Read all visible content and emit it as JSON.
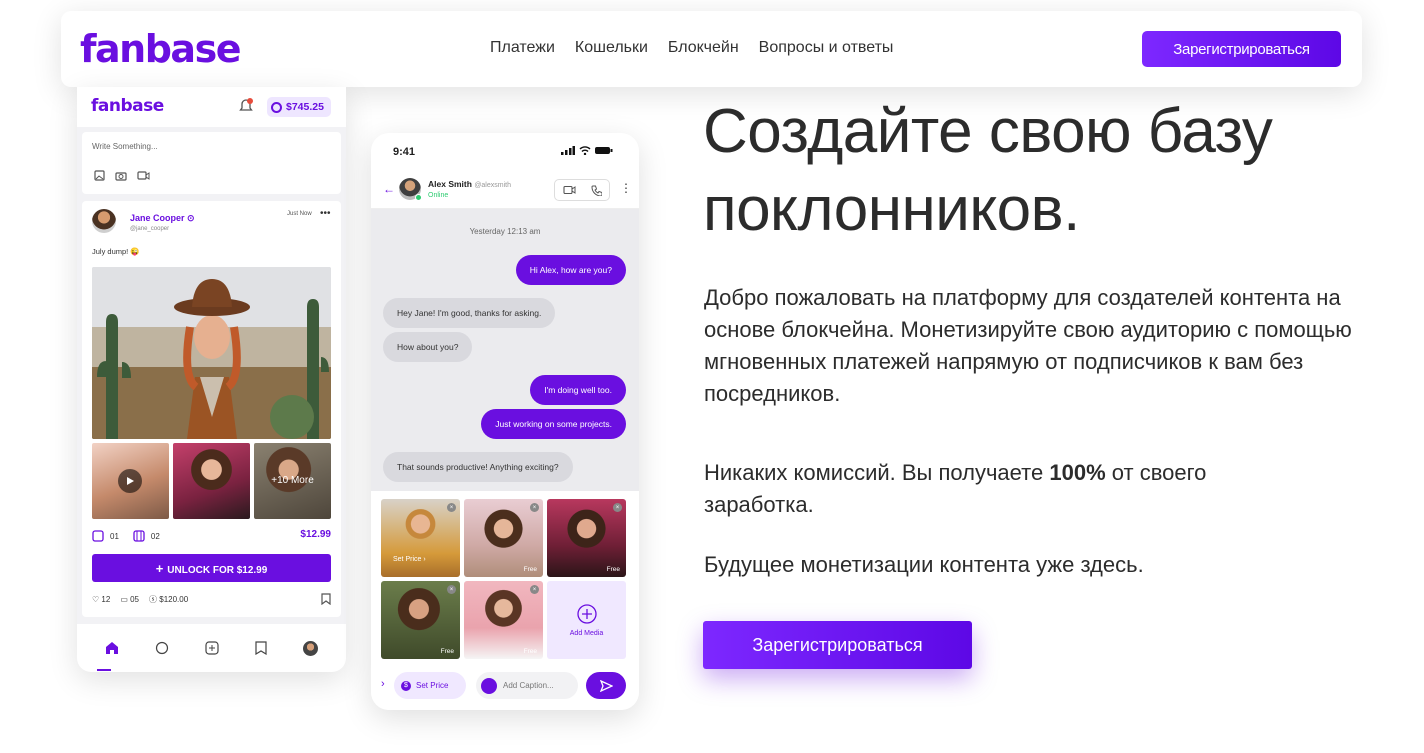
{
  "nav": {
    "logo": "fanbase",
    "links": [
      "Платежи",
      "Кошельки",
      "Блокчейн",
      "Вопросы и ответы"
    ],
    "register": "Зарегистрироваться"
  },
  "feed_mock": {
    "logo": "fanbase",
    "notification_count": "1",
    "balance": "$745.25",
    "write_placeholder": "Write Something...",
    "post": {
      "author": "Jane Cooper",
      "handle": "@jane_cooper",
      "time": "Just Now",
      "text": "July dump! 😜",
      "more_label": "+10 More",
      "images_count": "01",
      "videos_count": "02",
      "price": "$12.99",
      "unlock": "UNLOCK FOR $12.99",
      "likes": "12",
      "comments": "05",
      "tips": "$120.00"
    }
  },
  "phone_mock": {
    "time": "9:41",
    "contact": {
      "name": "Alex Smith",
      "handle": "@alexsmith",
      "status": "Online"
    },
    "day_label": "Yesterday 12:13 am",
    "messages": [
      {
        "dir": "out",
        "text": "Hi Alex, how are you?"
      },
      {
        "dir": "in",
        "text": "Hey Jane! I'm good, thanks for asking."
      },
      {
        "dir": "in",
        "text": "How about you?"
      },
      {
        "dir": "out",
        "text": "I'm doing well too."
      },
      {
        "dir": "out",
        "text": "Just working on some projects."
      },
      {
        "dir": "in",
        "text": "That sounds productive! Anything exciting?"
      }
    ],
    "media": {
      "set_price_label": "Set Price ›",
      "free_label": "Free",
      "add_media": "Add Media"
    },
    "compose": {
      "set_price": "Set Price",
      "caption_placeholder": "Add Caption..."
    }
  },
  "hero": {
    "title": "Создайте свою базу поклонников.",
    "p1": "Добро пожаловать на платформу для создателей контента на основе блокчейна. Монетизируйте свою аудиторию с помощью мгновенных платежей напрямую от подписчиков к вам без посредников.",
    "p2_pre": "Никаких комиссий. Вы получаете ",
    "p2_bold": "100%",
    "p2_post": " от своего заработка.",
    "p3": "Будущее монетизации контента уже здесь.",
    "cta": "Зарегистрироваться"
  },
  "colors": {
    "brand": "#6a0fe0",
    "online": "#2ecc71"
  }
}
